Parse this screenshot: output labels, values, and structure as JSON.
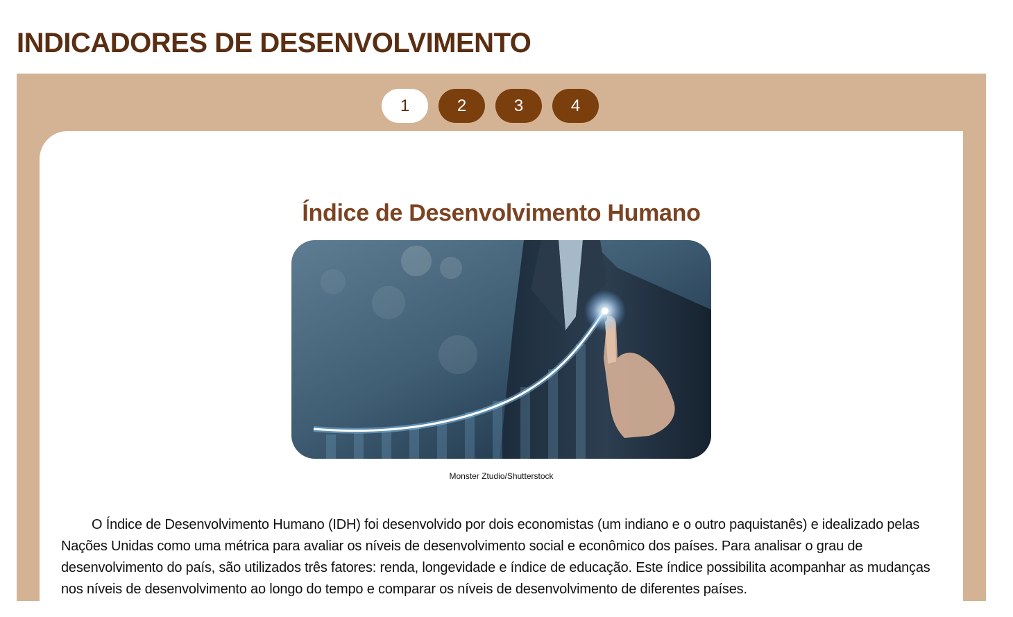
{
  "page": {
    "title": "INDICADORES DE DESENVOLVIMENTO"
  },
  "tabs": [
    {
      "label": "1",
      "active": true
    },
    {
      "label": "2",
      "active": false
    },
    {
      "label": "3",
      "active": false
    },
    {
      "label": "4",
      "active": false
    }
  ],
  "content": {
    "heading": "Índice de Desenvolvimento Humano",
    "image": {
      "icon": "businessman-pointing-growth-curve-photo",
      "credit": "Monster Ztudio/Shutterstock"
    },
    "paragraph": "O Índice de Desenvolvimento Humano (IDH) foi desenvolvido por dois economistas (um indiano e o outro paquistanês) e idealizado pelas Nações Unidas como uma métrica para avaliar os níveis de desenvolvimento social e econômico dos países. Para analisar o grau de desenvolvimento do país, são utilizados três fatores: renda, longevidade e índice de educação. Este índice possibilita acompanhar as mudanças nos níveis de desenvolvimento ao longo do tempo e comparar os níveis de desenvolvimento de diferentes países."
  },
  "colors": {
    "title": "#5a2e12",
    "frame": "#d4b395",
    "tab": "#7b3e0d",
    "tab_active": "#ffffff",
    "heading": "#7a4322"
  }
}
